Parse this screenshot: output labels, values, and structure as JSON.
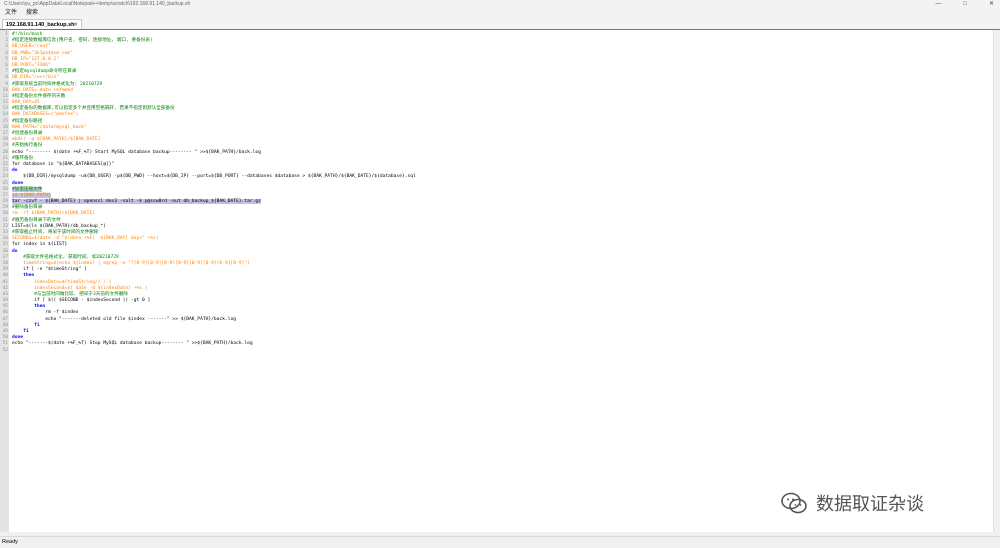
{
  "window": {
    "title": "C:\\Users\\yu_pc\\AppData\\Local\\Notepad++\\temp\\scratch\\192.168.91.140_backup.sh",
    "controls": [
      "—",
      "□",
      "✕"
    ]
  },
  "menu": {
    "items": [
      "文件",
      "搜索"
    ]
  },
  "tab": {
    "label": "192.168.91.140_backup.sh",
    "close": "✕"
  },
  "code_lines": [
    {
      "n": "1",
      "text": "#!/bin/bash",
      "cls": "c-comment"
    },
    {
      "n": "2",
      "text": "#指定连接数据库信息(用户名, 密码, 连接地址, 端口, 要备份表)",
      "cls": "c-comment"
    },
    {
      "n": "3",
      "text": "DB_USER=\"root\"",
      "cls": "c-var"
    },
    {
      "n": "4",
      "text": "DB_PWD=\"3k1pa$$vm.com\"",
      "cls": "c-var"
    },
    {
      "n": "5",
      "text": "DB_IP=\"127.0.0.1\"",
      "cls": "c-var"
    },
    {
      "n": "6",
      "text": "DB_PORT=\"3306\"",
      "cls": "c-var"
    },
    {
      "n": "7",
      "text": "#指定mysqldump命令所在目录",
      "cls": "c-comment"
    },
    {
      "n": "8",
      "text": "DB_DIR=\"/usr/bin\"",
      "cls": "c-var"
    },
    {
      "n": "9",
      "text": "#获取系统当前时间并格式化为: 20210729",
      "cls": "c-comment"
    },
    {
      "n": "10",
      "text": "BAK_DATE=`date +%Y%m%d`",
      "cls": "c-var"
    },
    {
      "n": "11",
      "text": "#指定备份文件保存的天数",
      "cls": "c-comment"
    },
    {
      "n": "12",
      "text": "BAK_DAY=45",
      "cls": "c-var"
    },
    {
      "n": "13",
      "text": "#指定备份的数据库,可以指定多个并且用空格隔开, 若果不指定则默认全部备份",
      "cls": "c-comment"
    },
    {
      "n": "14",
      "text": "BAK_DATABASES=(\"pmsfex\")",
      "cls": "c-var"
    },
    {
      "n": "15",
      "text": "#指定备份路径",
      "cls": "c-comment"
    },
    {
      "n": "16",
      "text": "BAK_PATH=\"/data/mysql_back\"",
      "cls": "c-var"
    },
    {
      "n": "17",
      "text": "#创建备份目录",
      "cls": "c-comment"
    },
    {
      "n": "18",
      "text": "mkdir -p $[BAK_PATH]/$[BAK_DATE]",
      "cls": "c-var"
    },
    {
      "n": "19",
      "text": "#开始执行备份",
      "cls": "c-comment"
    },
    {
      "n": "20",
      "text": "echo \"-------- $(date +%F_%T) Start MySQL database backup-------- \" >>${BAK_PATH}/back.log",
      "cls": "code"
    },
    {
      "n": "21",
      "text": "#循环备份",
      "cls": "c-comment"
    },
    {
      "n": "22",
      "text": "for database in \"${BAK_DATABASES[@]}\"",
      "cls": "code"
    },
    {
      "n": "23",
      "text": "do",
      "cls": "c-kw"
    },
    {
      "n": "24",
      "text": "    ${DB_DIR}/mysqldump -u${DB_USER} -p${DB_PWD} --host=${DB_IP} --port=${DB_PORT} --databases $database > ${BAK_PATH}/${BAK_DATE}/${database}.sql",
      "cls": "code"
    },
    {
      "n": "25",
      "text": "done",
      "cls": "c-kw"
    },
    {
      "n": "26",
      "text": "#加密压缩文件",
      "cls": "c-comment sel"
    },
    {
      "n": "27",
      "text": "cd ${BAK_PATH}",
      "cls": "c-var sel"
    },
    {
      "n": "28",
      "text": "tar -czvf - ${BAK_DATE} | openssl des3 -salt -k p@ssw0rd -out db_backup_${BAK_DATE}.tar.gz",
      "cls": "code sel"
    },
    {
      "n": "29",
      "text": "#删除备份目录",
      "cls": "c-comment"
    },
    {
      "n": "30",
      "text": "rm -rf ${BAK_PATH}/${BAK_DATE}",
      "cls": "c-var"
    },
    {
      "n": "31",
      "text": "#遍历备份目录下的文件",
      "cls": "c-comment"
    },
    {
      "n": "32",
      "text": "LIST=$(ls ${BAK_PATH}/db_backup_*)",
      "cls": "code"
    },
    {
      "n": "33",
      "text": "#获取截止时间, 将早于该时间的文件删除",
      "cls": "c-comment"
    },
    {
      "n": "34",
      "text": "SECONDS=$(date -d \"$(date +%F) -${BAK_DAY} days\" +%s)",
      "cls": "c-var"
    },
    {
      "n": "35",
      "text": "for index in ${LIST}",
      "cls": "code"
    },
    {
      "n": "36",
      "text": "do",
      "cls": "c-kw"
    },
    {
      "n": "37",
      "text": "    #获取文件名格式化, 获取时间, 如20210729",
      "cls": "c-comment"
    },
    {
      "n": "38",
      "text": "    timeString=$(echo ${index} | egrep -o \"?[0-9][0-9][0-9][0-9][0-9][0-9][0-9][0-9]\")",
      "cls": "c-var"
    },
    {
      "n": "39",
      "text": "    if [ -n \"$timeString\" ]",
      "cls": "code"
    },
    {
      "n": "40",
      "text": "    then",
      "cls": "c-kw"
    },
    {
      "n": "41",
      "text": "        indexDate=${timeString//./-}",
      "cls": "c-var"
    },
    {
      "n": "42",
      "text": "        indexSecond=$( date -d ${indexDate} +%s )",
      "cls": "c-var"
    },
    {
      "n": "43",
      "text": "        #与当前时间做比较, 把早于3天前的文件删除",
      "cls": "c-comment"
    },
    {
      "n": "44",
      "text": "        if [ $(( $SECOND - $indexSecond )) -gt 0 ]",
      "cls": "code"
    },
    {
      "n": "45",
      "text": "        then",
      "cls": "c-kw"
    },
    {
      "n": "46",
      "text": "            rm -f $index",
      "cls": "code"
    },
    {
      "n": "47",
      "text": "            echo \"-------deleted old file $index -------\" >> ${BAK_PATH}/back.log",
      "cls": "code"
    },
    {
      "n": "48",
      "text": "        fi",
      "cls": "c-kw"
    },
    {
      "n": "49",
      "text": "    fi",
      "cls": "c-kw"
    },
    {
      "n": "50",
      "text": "done",
      "cls": "c-kw"
    },
    {
      "n": "51",
      "text": "echo \"-------$(date +%F_%T) Stop MySQL database backup-------- \" >>${BAK_PATH}/back.log",
      "cls": "code"
    },
    {
      "n": "52",
      "text": "",
      "cls": "code"
    }
  ],
  "status": {
    "text": "Ready"
  },
  "watermark": {
    "text": "数据取证杂谈",
    "icon": "wechat-icon"
  }
}
